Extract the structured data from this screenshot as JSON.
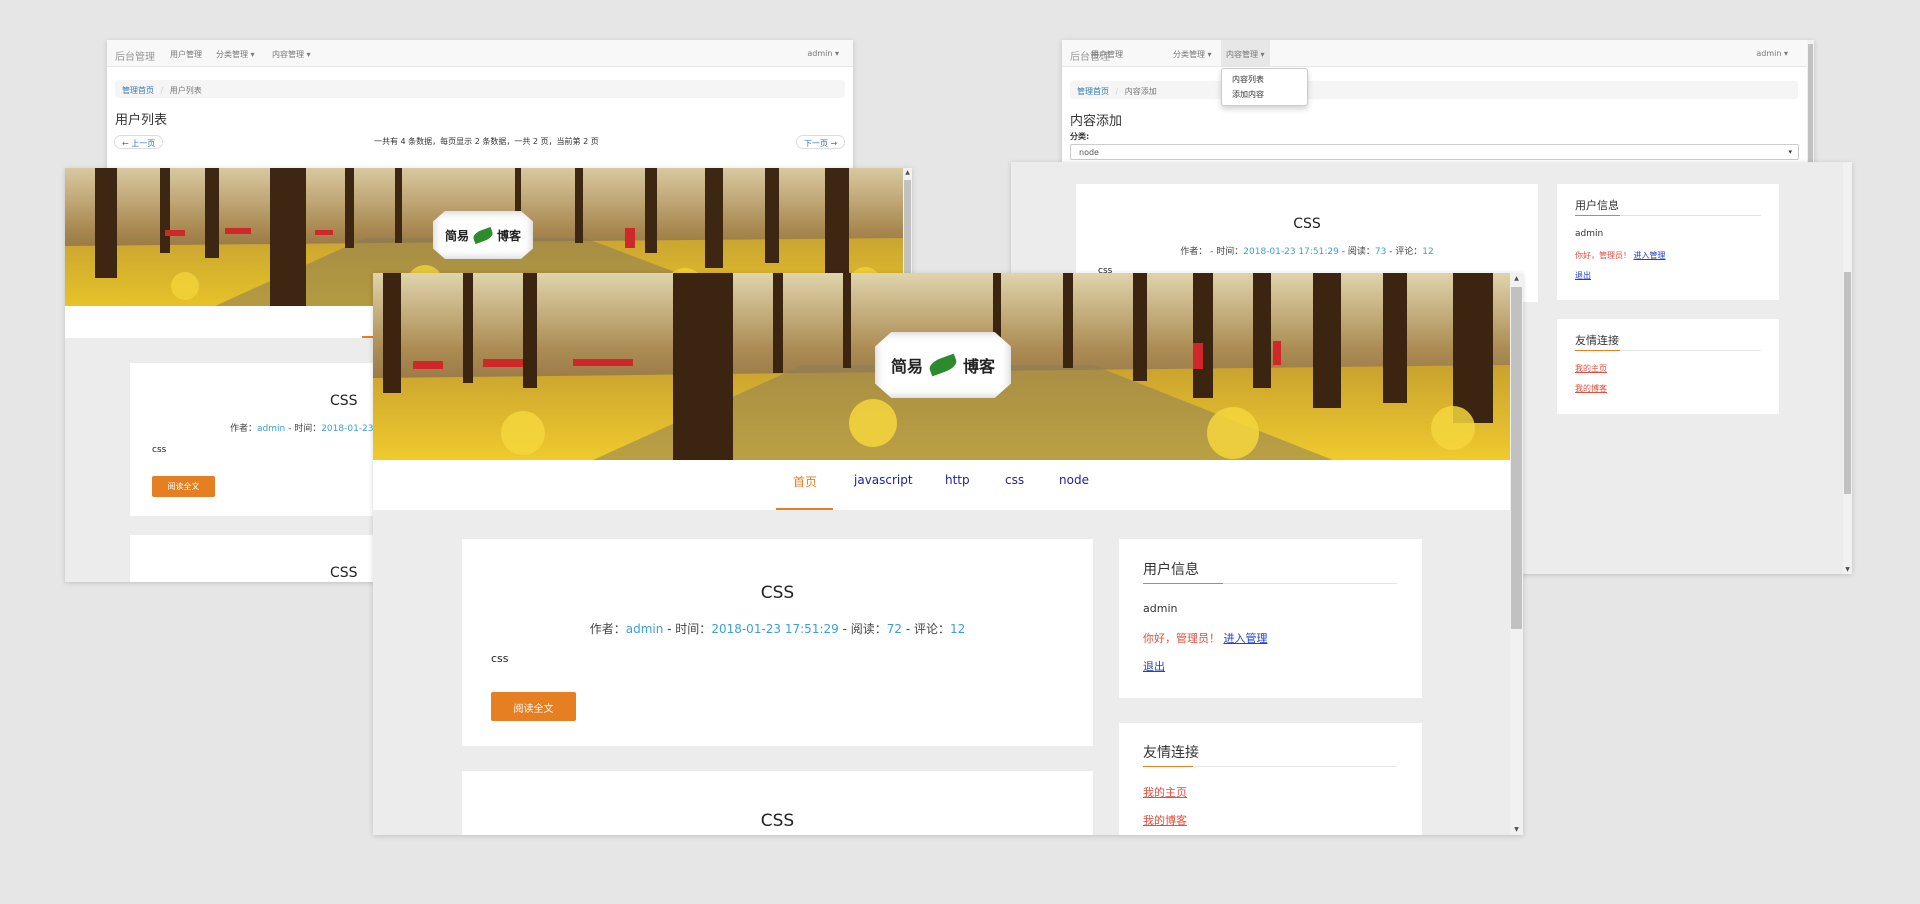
{
  "user_list_page": {
    "brand": "后台管理",
    "nav": [
      "用户管理",
      "分类管理 ▾",
      "内容管理 ▾"
    ],
    "user": "admin ▾",
    "breadcrumb": [
      "管理首页",
      "/",
      "用户列表"
    ],
    "title": "用户列表",
    "prev": "← 上一页",
    "next": "下一页 →",
    "pager_info": "一共有 4 条数据，每页显示 2 条数据，一共 2 页，当前第 2 页"
  },
  "content_add_page": {
    "brand": "后台管理",
    "nav": [
      "用户管理",
      "分类管理 ▾",
      "内容管理 ▾"
    ],
    "user": "admin ▾",
    "dropdown": [
      "内容列表",
      "添加内容"
    ],
    "breadcrumb": [
      "管理首页",
      "/",
      "内容添加"
    ],
    "title": "内容添加",
    "category_label": "分类:",
    "category_value": "node",
    "caret": "▾"
  },
  "blog": {
    "logo_left": "简易",
    "logo_right": "博客",
    "nav": [
      "首页",
      "javascript",
      "http",
      "css",
      "node"
    ],
    "post": {
      "title": "CSS",
      "title_lower": "css",
      "author_label": "作者：",
      "author": "admin",
      "time_label": " - 时间：",
      "time": "2018-01-23 17:51:29",
      "views_label": " - 阅读：",
      "views": "72",
      "comments_label": " - 评论：",
      "comments": "12",
      "body": "css",
      "read_more": "阅读全文"
    },
    "post_right": {
      "author_label": "作者：",
      "author": "",
      "time_label": " - 时间：",
      "time": "2018-01-23 17:51:29",
      "views_label": " - 阅读：",
      "views": "73",
      "comments_label": " - 评论：",
      "comments": "12",
      "body": "css"
    },
    "sidebar": {
      "user_title": "用户信息",
      "username": "admin",
      "greeting": "你好，管理员！",
      "admin_link": "进入管理",
      "logout": "退出",
      "links_title": "友情连接",
      "links": [
        "我的主页",
        "我的博客"
      ]
    }
  },
  "colors": {
    "accent": "#e67e22",
    "link": "#3aa0d8",
    "red": "#e74c3c"
  }
}
